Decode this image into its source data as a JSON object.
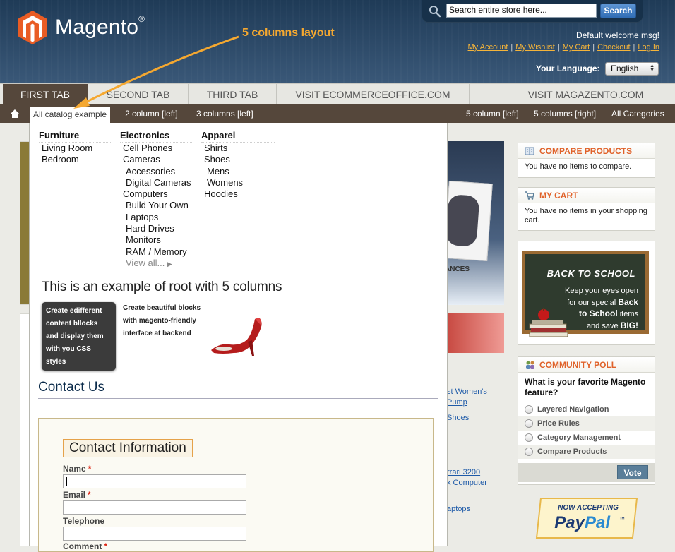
{
  "header": {
    "logo_text": "Magento",
    "logo_reg": "®",
    "search": {
      "value": "Search entire store here...",
      "button": "Search"
    },
    "welcome": "Default welcome msg!",
    "links": [
      "My Account",
      "My Wishlist",
      "My Cart",
      "Checkout",
      "Log In"
    ],
    "language_label": "Your Language:",
    "language_value": "English"
  },
  "annotation": {
    "label": "5 columns layout"
  },
  "tabs": [
    "FIRST TAB",
    "SECOND TAB",
    "THIRD TAB",
    "VISIT ECOMMERCEOFFICE.COM",
    "VISIT MAGAZENTO.COM"
  ],
  "subnav": {
    "left": [
      "All catalog example",
      "2 column [left]",
      "3 columns [left]"
    ],
    "right": [
      "5 column [left]",
      "5 columns [right]",
      "All Categories"
    ]
  },
  "menu": {
    "columns": [
      {
        "title": "Furniture",
        "items": [
          {
            "label": "Living Room"
          },
          {
            "label": "Bedroom"
          }
        ]
      },
      {
        "title": "Electronics",
        "items": [
          {
            "label": "Cell Phones"
          },
          {
            "label": "Cameras"
          },
          {
            "label": "Accessories",
            "sub": true
          },
          {
            "label": "Digital Cameras",
            "sub": true
          },
          {
            "label": "Computers"
          },
          {
            "label": "Build Your Own",
            "sub": true
          },
          {
            "label": "Laptops",
            "sub": true
          },
          {
            "label": "Hard Drives",
            "sub": true
          },
          {
            "label": "Monitors",
            "sub": true
          },
          {
            "label": "RAM / Memory",
            "sub": true
          },
          {
            "label": "View all...",
            "more": true
          }
        ]
      },
      {
        "title": "Apparel",
        "items": [
          {
            "label": "Shirts"
          },
          {
            "label": "Shoes"
          },
          {
            "label": "Mens",
            "sub": true
          },
          {
            "label": "Womens",
            "sub": true
          },
          {
            "label": "Hoodies"
          }
        ]
      }
    ],
    "root_title": "This is an example of root with 5 columns",
    "dark_box_text": "Create edifferent content bllocks and display them with you CSS styles",
    "create_text": "Create beautiful blocks with magento-friendly interface at backend"
  },
  "contact": {
    "title": "Contact Us",
    "legend": "Contact Information",
    "fields": [
      {
        "label": "Name",
        "required": true
      },
      {
        "label": "Email",
        "required": true
      },
      {
        "label": "Telephone",
        "required": false
      },
      {
        "label": "Comment",
        "required": true
      }
    ]
  },
  "background": {
    "banner_text": "ANCES",
    "links": [
      "st Women's",
      "Pump",
      "",
      "Shoes",
      "",
      "",
      "",
      "",
      "rrari 3200",
      "k Computer",
      "",
      "",
      "aptops"
    ]
  },
  "sidebar": {
    "compare": {
      "title": "COMPARE PRODUCTS",
      "text": "You have no items to compare."
    },
    "cart": {
      "title": "MY CART",
      "text": "You have no items in your shopping cart."
    },
    "school": {
      "title": "BACK TO SCHOOL",
      "line1": "Keep your eyes open",
      "line2a": "for our special",
      "line2b": "Back",
      "line3a": "to School",
      "line3b": "items",
      "line4a": "and save",
      "line4b": "BIG!"
    },
    "poll": {
      "title": "COMMUNITY POLL",
      "question": "What is your favorite Magento feature?",
      "options": [
        "Layered Navigation",
        "Price Rules",
        "Category Management",
        "Compare Products"
      ],
      "vote": "Vote"
    },
    "paypal": {
      "top": "NOW ACCEPTING",
      "brand_a": "Pay",
      "brand_b": "Pal",
      "tm": "™"
    }
  },
  "colors": {
    "accent": "#e0622a",
    "tab_bar": "#55473b",
    "link": "#f5b43a",
    "annotation": "#f5a830"
  }
}
